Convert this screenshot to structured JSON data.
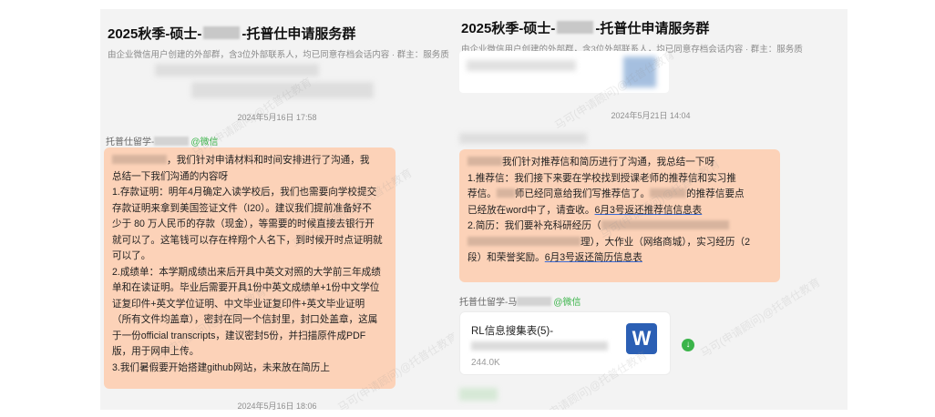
{
  "left": {
    "title_prefix": "2025秋季-硕士-",
    "title_suffix": "-托普仕申请服务群",
    "subtitle": "由企业微信用户创建的外部群，含3位外部联系人，均已同意存档会话内容 · 群主：服务质",
    "timestamp1": "2024年5月16日 17:58",
    "sender_name": "托普仕留学-",
    "sender_tag": "@微信",
    "msg_line1_suffix": "，我们针对申请材料和时间安排进行了沟通，我",
    "msg_lines": [
      "总结一下我们沟通的内容呀",
      "1.存款证明：明年4月确定入读学校后，我们也需要向学校提交",
      "存款证明来拿到美国签证文件（I20）。建议我们提前准备好不",
      "少于 80 万人民币的存款（现金），等需要的时候直接去银行开",
      "就可以了。这笔钱可以存在梓翔个人名下，到时候开时点证明就",
      "可以了。",
      "2.成绩单：本学期成绩出来后开具中英文对照的大学前三年成绩",
      "单和在读证明。毕业后需要开具1份中英文成绩单+1份中文学位",
      "证复印件+英文学位证明、中文毕业证复印件+英文毕业证明",
      "（所有文件均盖章），密封在同一个信封里，封口处盖章，这属",
      "于一份official transcripts，建议密封5份，并扫描原件成PDF",
      "版，用于网申上传。",
      "3.我们暑假要开始搭建github网站，未来放在简历上"
    ],
    "timestamp2": "2024年5月16日 18:06"
  },
  "right": {
    "title_prefix": "2025秋季-硕士-",
    "title_suffix": "-托普仕申请服务群",
    "subtitle": "由企业微信用户创建的外部群，含3位外部联系人，均已同意存档会话内容 · 群主：服务质",
    "timestamp1": "2024年5月21日 14:04",
    "msg_line1_suffix": "我们针对推荐信和简历进行了沟通，我总结一下呀",
    "rec_line1": "1.推荐信：我们接下来要在学校找到授课老师的推荐信和实习推",
    "rec_line2_a": "荐信。",
    "rec_line2_b": "师已经同意给我们写推荐信了。",
    "rec_line2_c": "的推荐信要点",
    "rec_line3_a": "已经放在word中了，请查收。",
    "rec_line3_b": "6月3号返还推荐信信息表",
    "cv_line1": "2.简历：我们要补充科研经历（",
    "cv_line2": "理），大作业（网络商城），实习经历（2",
    "cv_line3_a": "段）和荣誉奖励。",
    "cv_line3_b": "6月3号返还简历信息表",
    "sender_name": "托普仕留学-马",
    "sender_tag": "@微信",
    "file_name": "RL信息搜集表(5)-",
    "file_size": "244.0K",
    "file_icon_letter": "W",
    "file_icon": "word-icon",
    "download_icon": "download-icon"
  },
  "watermark_text": "马可(申请顾问)@托普仕教育",
  "colors": {
    "bubble": "#fcd2b8",
    "panel": "#f3f3f3",
    "wechat_green": "#3bb44a",
    "word_blue": "#2b5fb4"
  }
}
